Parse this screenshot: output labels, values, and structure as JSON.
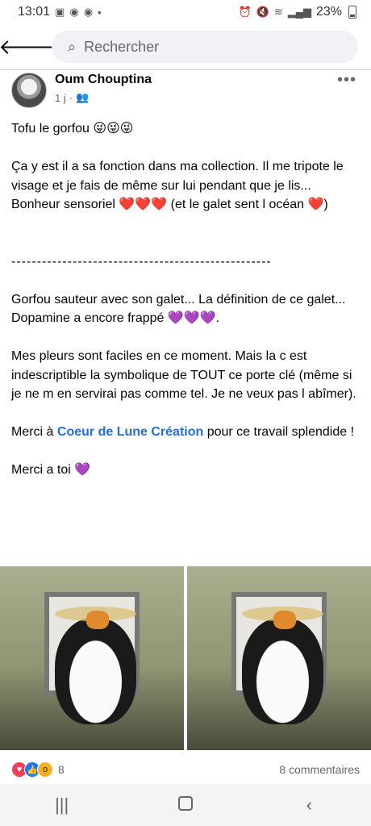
{
  "status_bar": {
    "time": "13:01",
    "left_icons": [
      "image-icon",
      "messenger-icon",
      "messenger-icon",
      "dot-icon"
    ],
    "right_icons": [
      "alarm-icon",
      "mute-icon",
      "wifi-icon",
      "signal-icon"
    ],
    "battery": "23%"
  },
  "top_bar": {
    "back_icon": "arrow-left-icon",
    "search_placeholder": "Rechercher"
  },
  "post": {
    "author": "Oum Chouptina",
    "time": "1 j",
    "audience_icon": "friends-icon",
    "more_icon": "•••",
    "lines": {
      "l1": "Tofu le gorfou 😜😜😜",
      "l2": "Ça y est il a sa fonction dans ma collection. Il me tripote le visage et je fais de même sur lui pendant que je lis... Bonheur sensoriel ❤️❤️❤️ (et le galet sent l océan ❤️)",
      "l3": "---------------------------------------------------",
      "l4": "Gorfou sauteur avec son galet... La définition de ce galet...",
      "l5": "Dopamine a encore frappé 💜💜💜.",
      "l6": "Mes pleurs sont faciles en ce moment. Mais la c est indescriptible la symbolique de TOUT ce porte clé (même si je ne m en servirai pas comme tel. Je ne veux pas l abîmer).",
      "l7_prefix": "Merci à ",
      "l7_link": "Coeur de Lune Création",
      "l7_suffix": " pour ce travail splendide !",
      "l8": "Merci a toi 💜"
    }
  },
  "reactions": {
    "icons": [
      "love-reaction-icon",
      "like-reaction-icon",
      "wow-reaction-icon"
    ],
    "count": "8",
    "comments": "8 commentaires"
  },
  "nav_bar": {
    "recents_icon": "|||",
    "home_icon": "home-icon",
    "back_icon": "‹"
  }
}
